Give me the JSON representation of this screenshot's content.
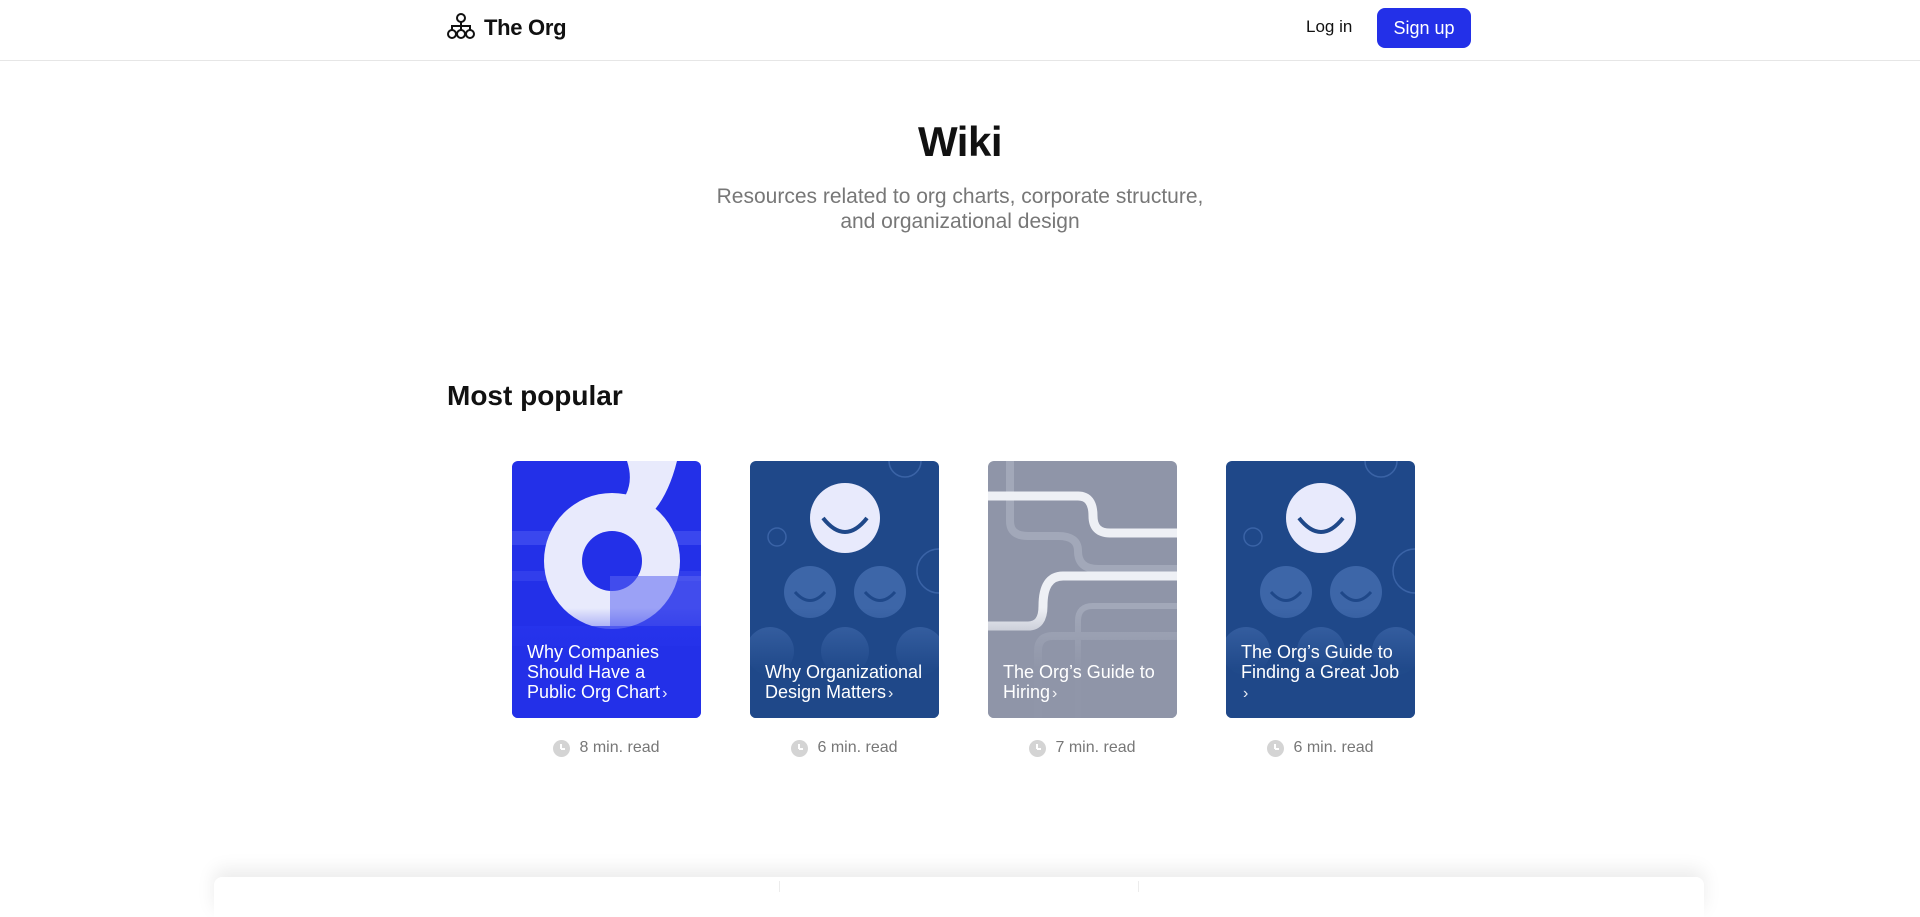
{
  "header": {
    "brand": "The Org",
    "login_label": "Log in",
    "signup_label": "Sign up"
  },
  "hero": {
    "title": "Wiki",
    "subtitle_line1": "Resources related to org charts, corporate structure,",
    "subtitle_line2": "and organizational design"
  },
  "popular": {
    "title": "Most popular",
    "articles": [
      {
        "title": "Why Companies Should Have a Public Org Chart",
        "read_time": "8 min. read",
        "color": "#2330e8"
      },
      {
        "title": "Why Organizational Design Matters",
        "read_time": "6 min. read",
        "color": "#1f4889"
      },
      {
        "title": "The Org’s Guide to Hiring",
        "read_time": "7 min. read",
        "color": "#8f95a8"
      },
      {
        "title": "The Org’s Guide to Finding a Great Job",
        "read_time": "6 min. read",
        "color": "#1f4889"
      }
    ]
  },
  "colors": {
    "accent": "#2330e8",
    "navy": "#1f4889",
    "gray_card": "#8f95a8"
  }
}
